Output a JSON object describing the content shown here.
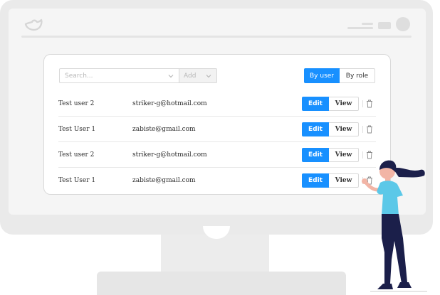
{
  "toolbar": {
    "search_placeholder": "Search...",
    "add_placeholder": "Add"
  },
  "toggle": {
    "by_user": "By user",
    "by_role": "By role"
  },
  "users": [
    {
      "name": "Test user 2",
      "email": "striker-g@hotmail.com",
      "edit": "Edit",
      "view": "View"
    },
    {
      "name": "Test User 1",
      "email": "zabiste@gmail.com",
      "edit": "Edit",
      "view": "View"
    },
    {
      "name": "Test user 2",
      "email": "striker-g@hotmail.com",
      "edit": "Edit",
      "view": "View"
    },
    {
      "name": "Test User 1",
      "email": "zabiste@gmail.com",
      "edit": "Edit",
      "view": "View"
    }
  ],
  "colors": {
    "accent": "#1890ff",
    "monitor": "#eaeaea",
    "shirt": "#5bc8e8",
    "pants": "#1b1f4a"
  },
  "icons": [
    "bird-logo-icon",
    "menu-lines-icon",
    "chevron-down-icon",
    "trash-icon"
  ]
}
